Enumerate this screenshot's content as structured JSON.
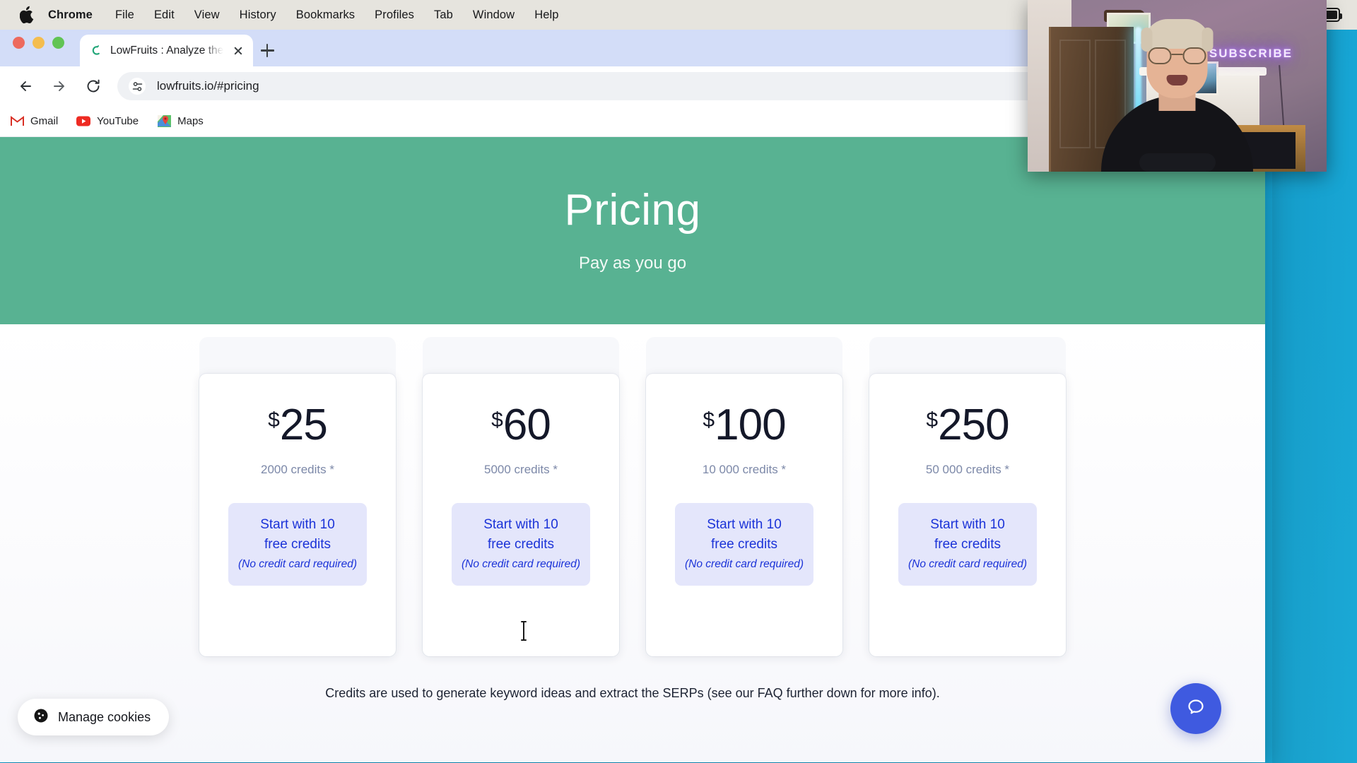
{
  "menubar": {
    "apple_icon": "apple-logo",
    "items": [
      "Chrome",
      "File",
      "Edit",
      "View",
      "History",
      "Bookmarks",
      "Profiles",
      "Tab",
      "Window",
      "Help"
    ],
    "active_item": "Chrome",
    "status_icons": [
      "screen-share-icon",
      "screen-recording-icon",
      "play-circle-icon",
      "battery-icon"
    ]
  },
  "browser": {
    "window_controls": [
      "close",
      "minimize",
      "maximize"
    ],
    "tab": {
      "title": "LowFruits : Analyze the SERP",
      "favicon": "lowfruits-leaf-icon",
      "close_label": "×"
    },
    "new_tab_label": "+",
    "toolbar": {
      "back_icon": "back-arrow-icon",
      "forward_icon": "forward-arrow-icon",
      "reload_icon": "reload-icon",
      "site_settings_icon": "tune-icon",
      "url": "lowfruits.io/#pricing"
    },
    "bookmarks": [
      {
        "label": "Gmail",
        "icon": "gmail-icon"
      },
      {
        "label": "YouTube",
        "icon": "youtube-icon"
      },
      {
        "label": "Maps",
        "icon": "google-maps-icon"
      }
    ]
  },
  "page": {
    "hero": {
      "title": "Pricing",
      "subtitle": "Pay as you go",
      "bg_color": "#58b292"
    },
    "plans": [
      {
        "currency": "$",
        "price": "25",
        "credits": "2000 credits *",
        "cta_line1": "Start with 10",
        "cta_line2": "free credits",
        "cta_note": "(No credit card required)"
      },
      {
        "currency": "$",
        "price": "60",
        "credits": "5000 credits *",
        "cta_line1": "Start with 10",
        "cta_line2": "free credits",
        "cta_note": "(No credit card required)"
      },
      {
        "currency": "$",
        "price": "100",
        "credits": "10 000 credits *",
        "cta_line1": "Start with 10",
        "cta_line2": "free credits",
        "cta_note": "(No credit card required)"
      },
      {
        "currency": "$",
        "price": "250",
        "credits": "50 000 credits *",
        "cta_line1": "Start with 10",
        "cta_line2": "free credits",
        "cta_note": "(No credit card required)"
      }
    ],
    "footnote": "Credits are used to generate keyword ideas and extract the SERPs (see our FAQ further down for more info).",
    "cookie_banner": {
      "label": "Manage cookies",
      "icon": "cookie-icon"
    },
    "chat_widget": {
      "icon": "chat-bubble-icon",
      "color": "#3f5ae0"
    },
    "cta_bg_color": "#e4e6fb",
    "cta_text_color": "#1b33d8"
  },
  "webcam_overlay": {
    "neon_sign_text": "SUBSCRIBE",
    "description": "presenter-webcam-feed"
  },
  "desktop": {
    "background_color": "#12a7d8"
  }
}
